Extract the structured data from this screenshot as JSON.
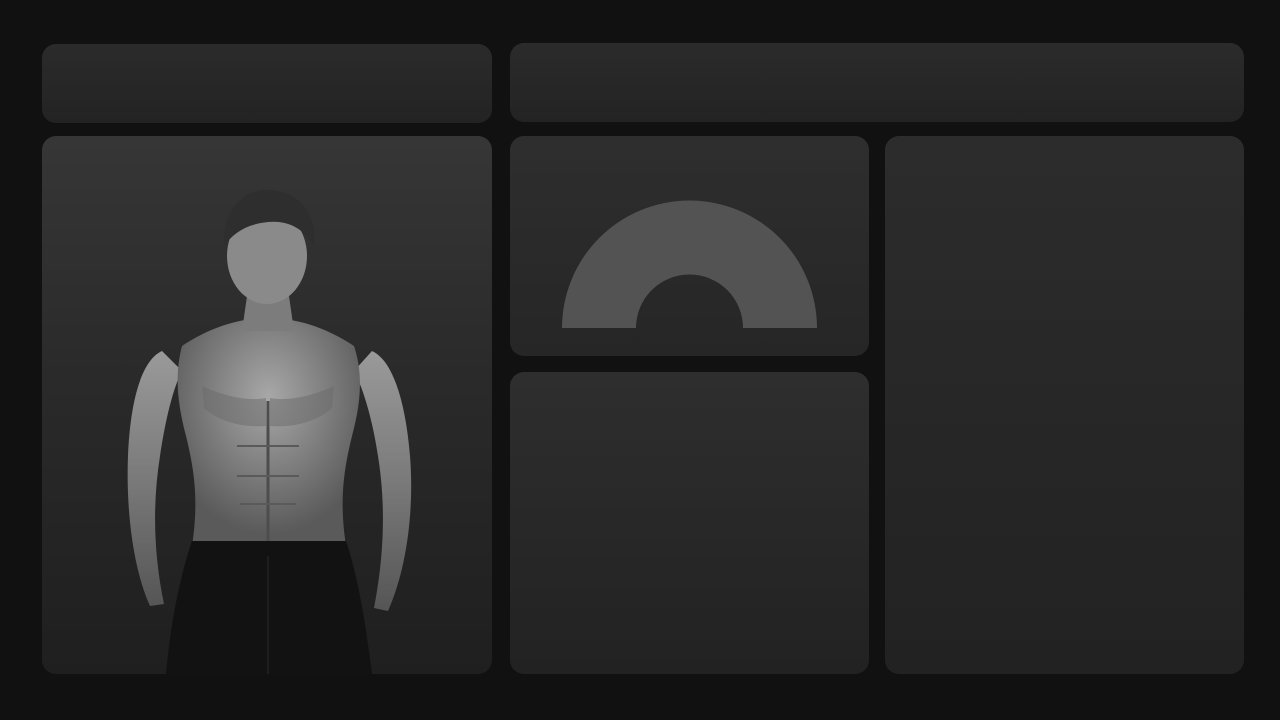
{
  "colors": {
    "page_background": "#111111",
    "panel_background": "#2a2a2a",
    "gauge_arc": "#535353"
  },
  "hero": {
    "image_subject": "shirtless-athlete-photo"
  },
  "gauge": {
    "icon": "half-donut-gauge",
    "value": null
  }
}
